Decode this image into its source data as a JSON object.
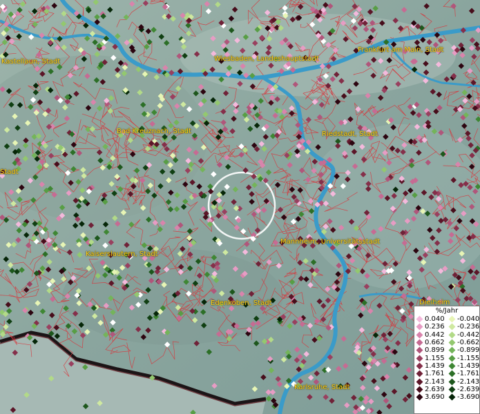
{
  "map": {
    "cities": [
      {
        "name": "Kastellaun, Stadt",
        "id": "kastellaun"
      },
      {
        "name": "Wiesbaden, Landeshauptstadt",
        "id": "wiesbaden"
      },
      {
        "name": "Frankfurt am Main, Stadt",
        "id": "frankfurt"
      },
      {
        "name": "Bad Kreuznach, Stadt",
        "id": "bad-kreuznach"
      },
      {
        "name": "Riedstadt, Stadt",
        "id": "riedstadt"
      },
      {
        "name": "Stadt",
        "id": "stadt-left"
      },
      {
        "name": "Mannheim, Universitätsstadt",
        "id": "mannheim"
      },
      {
        "name": "Kaiserslautern, Stadt",
        "id": "kaiserslautern"
      },
      {
        "name": "Edenkoben, Stadt",
        "id": "edenkoben"
      },
      {
        "name": "Dielheim",
        "id": "dielheim"
      },
      {
        "name": "Karlsruhe, Stadt",
        "id": "karlsruhe"
      }
    ],
    "colors": {
      "river": "#3a9bc9",
      "borders": "#d9343a",
      "label": "#ffd21a"
    }
  },
  "legend": {
    "unit": "%/Jahr",
    "positive": [
      {
        "label": "0.040",
        "color": "#f4b9dc"
      },
      {
        "label": "0.236",
        "color": "#e79cc4"
      },
      {
        "label": "0.442",
        "color": "#d984ac"
      },
      {
        "label": "0.662",
        "color": "#c66b93"
      },
      {
        "label": "0.899",
        "color": "#b0567b"
      },
      {
        "label": "1.155",
        "color": "#99405f"
      },
      {
        "label": "1.439",
        "color": "#852f4a"
      },
      {
        "label": "1.761",
        "color": "#702238"
      },
      {
        "label": "2.143",
        "color": "#5c1628"
      },
      {
        "label": "2.639",
        "color": "#470d1b"
      },
      {
        "label": "3.690",
        "color": "#2c0510"
      }
    ],
    "negative": [
      {
        "label": "-0.040",
        "color": "#e7f5b5"
      },
      {
        "label": "-0.236",
        "color": "#cfe9a0"
      },
      {
        "label": "-0.442",
        "color": "#b2da88"
      },
      {
        "label": "-0.662",
        "color": "#93c86f"
      },
      {
        "label": "-0.899",
        "color": "#74b45a"
      },
      {
        "label": "-1.155",
        "color": "#589e45"
      },
      {
        "label": "-1.439",
        "color": "#3f8734"
      },
      {
        "label": "-1.761",
        "color": "#2c6f27"
      },
      {
        "label": "-2.143",
        "color": "#1d571c"
      },
      {
        "label": "-2.639",
        "color": "#103f12"
      },
      {
        "label": "-3.690",
        "color": "#062608"
      }
    ]
  }
}
